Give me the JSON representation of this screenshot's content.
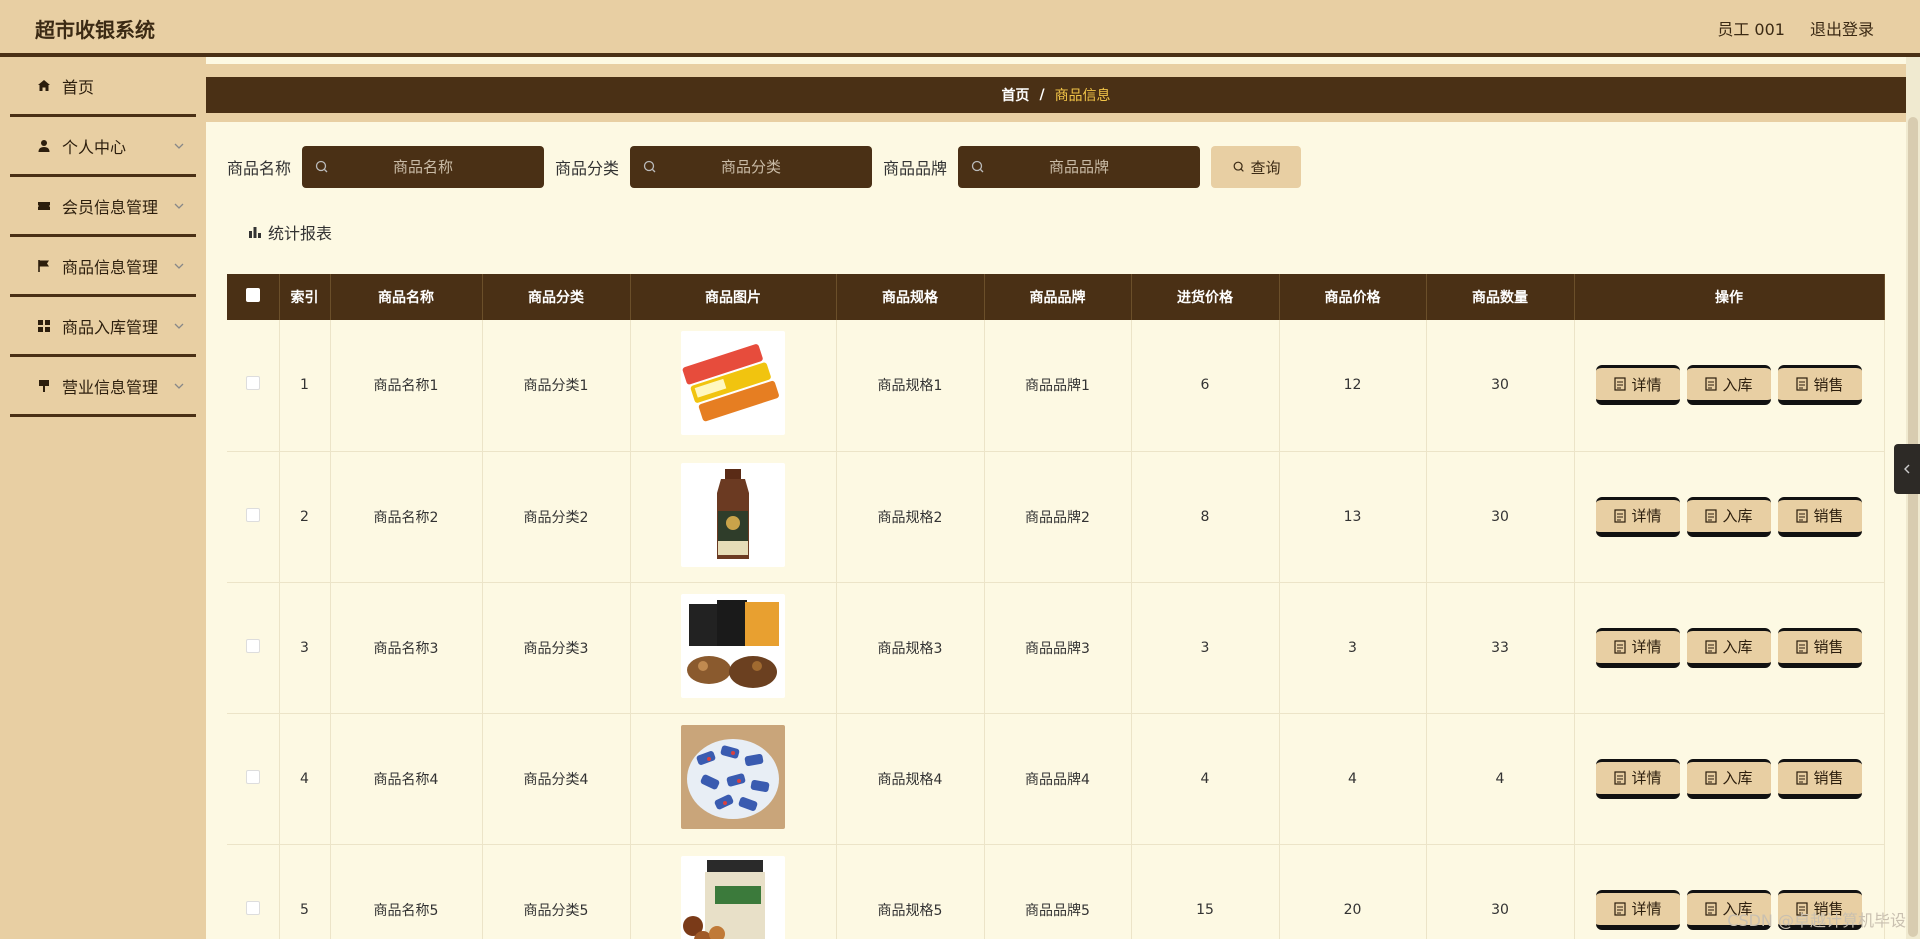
{
  "header": {
    "title": "超市收银系统",
    "user": "员工 001",
    "logout": "退出登录"
  },
  "sidebar": {
    "items": [
      {
        "label": "首页",
        "icon": "home-icon"
      },
      {
        "label": "个人中心",
        "icon": "user-icon"
      },
      {
        "label": "会员信息管理",
        "icon": "ticket-icon"
      },
      {
        "label": "商品信息管理",
        "icon": "flag-icon"
      },
      {
        "label": "商品入库管理",
        "icon": "grid-icon"
      },
      {
        "label": "营业信息管理",
        "icon": "signpost-icon"
      }
    ]
  },
  "breadcrumb": {
    "home": "首页",
    "sep": "/",
    "current": "商品信息"
  },
  "search": {
    "name_label": "商品名称",
    "name_placeholder": "商品名称",
    "category_label": "商品分类",
    "category_placeholder": "商品分类",
    "brand_label": "商品品牌",
    "brand_placeholder": "商品品牌",
    "query_label": "查询"
  },
  "stats_link": "统计报表",
  "table": {
    "headers": [
      "索引",
      "商品名称",
      "商品分类",
      "商品图片",
      "商品规格",
      "商品品牌",
      "进货价格",
      "商品价格",
      "商品数量",
      "操作"
    ],
    "rows": [
      {
        "index": "1",
        "name": "商品名称1",
        "category": "商品分类1",
        "spec": "商品规格1",
        "brand": "商品品牌1",
        "cost": "6",
        "price": "12",
        "qty": "30"
      },
      {
        "index": "2",
        "name": "商品名称2",
        "category": "商品分类2",
        "spec": "商品规格2",
        "brand": "商品品牌2",
        "cost": "8",
        "price": "13",
        "qty": "30"
      },
      {
        "index": "3",
        "name": "商品名称3",
        "category": "商品分类3",
        "spec": "商品规格3",
        "brand": "商品品牌3",
        "cost": "3",
        "price": "3",
        "qty": "33"
      },
      {
        "index": "4",
        "name": "商品名称4",
        "category": "商品分类4",
        "spec": "商品规格4",
        "brand": "商品品牌4",
        "cost": "4",
        "price": "4",
        "qty": "4"
      },
      {
        "index": "5",
        "name": "商品名称5",
        "category": "商品分类5",
        "spec": "商品规格5",
        "brand": "商品品牌5",
        "cost": "15",
        "price": "20",
        "qty": "30"
      }
    ],
    "actions": {
      "detail": "详情",
      "stock": "入库",
      "sell": "销售"
    }
  },
  "watermark": "CSDN @卓越计算机毕设",
  "colors": {
    "primary_dark": "#4a3015",
    "accent_tan": "#e8cfa3",
    "bg_cream": "#fdf9e3",
    "breadcrumb_current": "#f2c548"
  }
}
